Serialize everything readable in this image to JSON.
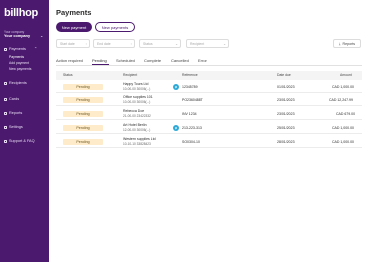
{
  "sidebar": {
    "logo": "billhop",
    "company_caption": "Your company",
    "company_name": "Your company",
    "nav": [
      {
        "label": "Payments",
        "icon": "payments-icon"
      },
      {
        "label": "Recipients",
        "icon": "recipients-icon"
      },
      {
        "label": "Cards",
        "icon": "card-icon"
      },
      {
        "label": "Reports",
        "icon": "reports-icon"
      },
      {
        "label": "Settings",
        "icon": "gear-icon"
      },
      {
        "label": "Support & FAQ",
        "icon": "help-icon"
      }
    ],
    "payments_sub": [
      "Payments",
      "Add payment",
      "New payments"
    ]
  },
  "main": {
    "title": "Payments",
    "new_payment": "New payment",
    "new_payments": "New payments",
    "filters": [
      "Start date",
      "End date",
      "Status",
      "Recipient"
    ],
    "reports": "Reports",
    "tabs": [
      "Action required",
      "Pending",
      "Scheduled",
      "Complete",
      "Cancelled",
      "Error"
    ],
    "columns": [
      "Status",
      "Recipient",
      "Reference",
      "Date due",
      "Amount"
    ],
    "rows": [
      {
        "status": "Pending",
        "recipient": "Happy Tours Ltd",
        "recipient_sub": "10-00-00 30006(...)",
        "ref_icon": true,
        "reference": "12345789",
        "date": "01/01/2023",
        "amount": "CAD 1,000.00"
      },
      {
        "status": "Pending",
        "recipient": "Office supplies 101",
        "recipient_sub": "10-00-00 30006(...)",
        "ref_icon": false,
        "reference": "PO2360488T",
        "date": "23/01/2023",
        "amount": "CAD 12,247.99"
      },
      {
        "status": "Pending",
        "recipient": "Rebecca Doe",
        "recipient_sub": "21-00-00 23422332",
        "ref_icon": false,
        "reference": "INV 1234",
        "date": "23/01/2023",
        "amount": "CAD 679.00"
      },
      {
        "status": "Pending",
        "recipient": "Art Hotel Berlin",
        "recipient_sub": "12-00-00 30006(...)",
        "ref_icon": true,
        "reference": "213-223-313",
        "date": "25/01/2023",
        "amount": "CAD 1,000.00"
      },
      {
        "status": "Pending",
        "recipient": "Western supplies Ltd",
        "recipient_sub": "10-10-10 33828423",
        "ref_icon": false,
        "reference": "SO0304-10",
        "date": "28/01/2023",
        "amount": "CAD 1,000.00"
      }
    ]
  },
  "colors": {
    "brand": "#4b1a6e",
    "pending_bg": "#fdebc9",
    "ref_icon": "#2eaad8"
  }
}
